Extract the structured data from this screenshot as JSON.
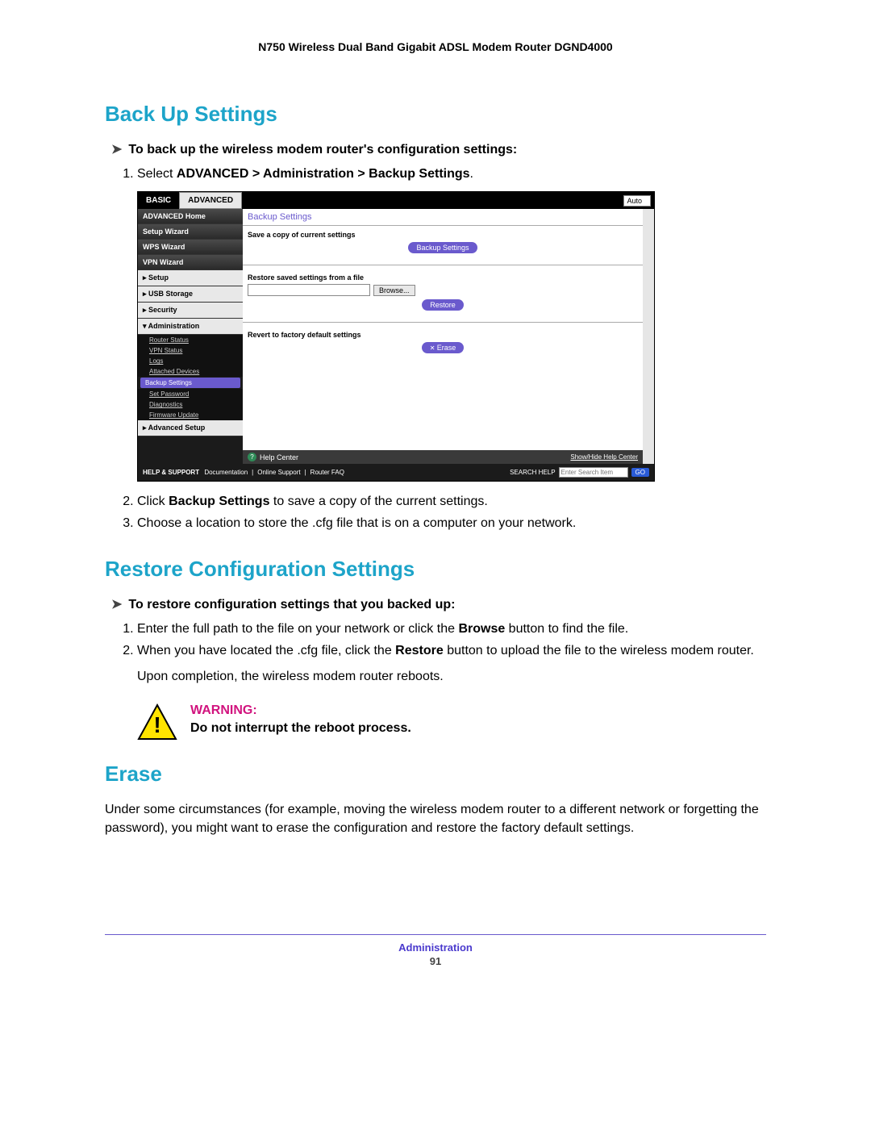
{
  "header": {
    "title": "N750 Wireless Dual Band Gigabit ADSL Modem Router DGND4000"
  },
  "sections": {
    "backup": {
      "heading": "Back Up Settings",
      "arrow_line": "To back up the wireless modem router's configuration settings:",
      "step1_pre": "Select ",
      "step1_bold": "ADVANCED > Administration > Backup Settings",
      "step1_post": ".",
      "step2_pre": "Click ",
      "step2_bold": "Backup Settings",
      "step2_post": " to save a copy of the current settings.",
      "step3": "Choose a location to store the .cfg file that is on a computer on your network."
    },
    "restore": {
      "heading": "Restore Configuration Settings",
      "arrow_line": "To restore configuration settings that you backed up:",
      "step1_pre": "Enter the full path to the file on your network or click the ",
      "step1_bold": "Browse",
      "step1_post": " button to find the file.",
      "step2_pre": "When you have located the .cfg file, click the ",
      "step2_bold": "Restore",
      "step2_post": " button to upload the file to the wireless modem router.",
      "para_after": "Upon completion, the wireless modem router reboots.",
      "warn_label": "WARNING:",
      "warn_text": "Do not interrupt the reboot process."
    },
    "erase": {
      "heading": "Erase",
      "body": "Under some circumstances (for example, moving the wireless modem router to a different network or forgetting the password), you might want to erase the configuration and restore the factory default settings."
    }
  },
  "shot": {
    "tabs": {
      "basic": "BASIC",
      "advanced": "ADVANCED",
      "auto": "Auto"
    },
    "sidebar": {
      "adv_home": "ADVANCED Home",
      "setup_wiz": "Setup Wizard",
      "wps_wiz": "WPS Wizard",
      "vpn_wiz": "VPN Wizard",
      "setup": "▸ Setup",
      "usb": "▸ USB Storage",
      "security": "▸ Security",
      "admin": "▾ Administration",
      "subs": {
        "router_status": "Router Status",
        "vpn_status": "VPN Status",
        "logs": "Logs",
        "attached": "Attached Devices",
        "backup": "Backup Settings",
        "setpw": "Set Password",
        "diag": "Diagnostics",
        "fw": "Firmware Update"
      },
      "adv_setup": "▸ Advanced Setup"
    },
    "content": {
      "title": "Backup Settings",
      "save_label": "Save a copy of current settings",
      "btn_backup": "Backup Settings",
      "restore_label": "Restore saved settings from a file",
      "btn_browse": "Browse...",
      "btn_restore": "Restore",
      "revert_label": "Revert to factory default settings",
      "btn_erase": "Erase"
    },
    "helpcenter": {
      "label": "Help Center",
      "showhide": "Show/Hide Help Center"
    },
    "footer": {
      "hs": "HELP & SUPPORT",
      "doc": "Documentation",
      "online": "Online Support",
      "faq": "Router FAQ",
      "search_label": "SEARCH HELP",
      "search_ph": "Enter Search Item",
      "go": "GO"
    }
  },
  "footer": {
    "label": "Administration",
    "page": "91"
  }
}
